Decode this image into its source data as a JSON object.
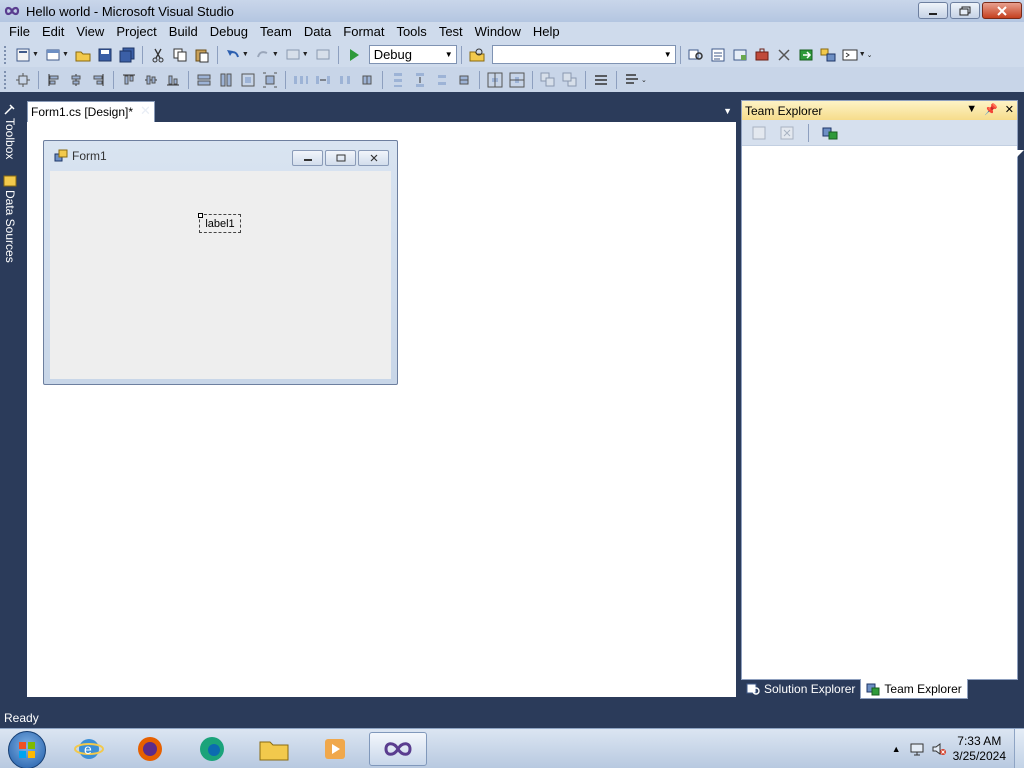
{
  "window": {
    "title": "Hello world - Microsoft Visual Studio",
    "icon": "visual-studio-infinity-icon"
  },
  "menu": {
    "items": [
      "File",
      "Edit",
      "View",
      "Project",
      "Build",
      "Debug",
      "Team",
      "Data",
      "Format",
      "Tools",
      "Test",
      "Window",
      "Help"
    ]
  },
  "toolbar1": {
    "config_select": "Debug",
    "platform_select": ""
  },
  "side_tabs": {
    "toolbox": "Toolbox",
    "data_sources": "Data Sources"
  },
  "document": {
    "tab_label": "Form1.cs [Design]*"
  },
  "form_designer": {
    "form_title": "Form1",
    "label_text": "label1"
  },
  "team_explorer": {
    "title": "Team Explorer"
  },
  "bottom_tabs": {
    "solution_explorer": "Solution Explorer",
    "team_explorer": "Team Explorer"
  },
  "status": {
    "text": "Ready"
  },
  "taskbar": {
    "time": "7:33 AM",
    "date": "3/25/2024"
  },
  "colors": {
    "frame": "#2b3b5a",
    "toolbar": "#cfdbec",
    "te_header": "#f6dc8b"
  }
}
